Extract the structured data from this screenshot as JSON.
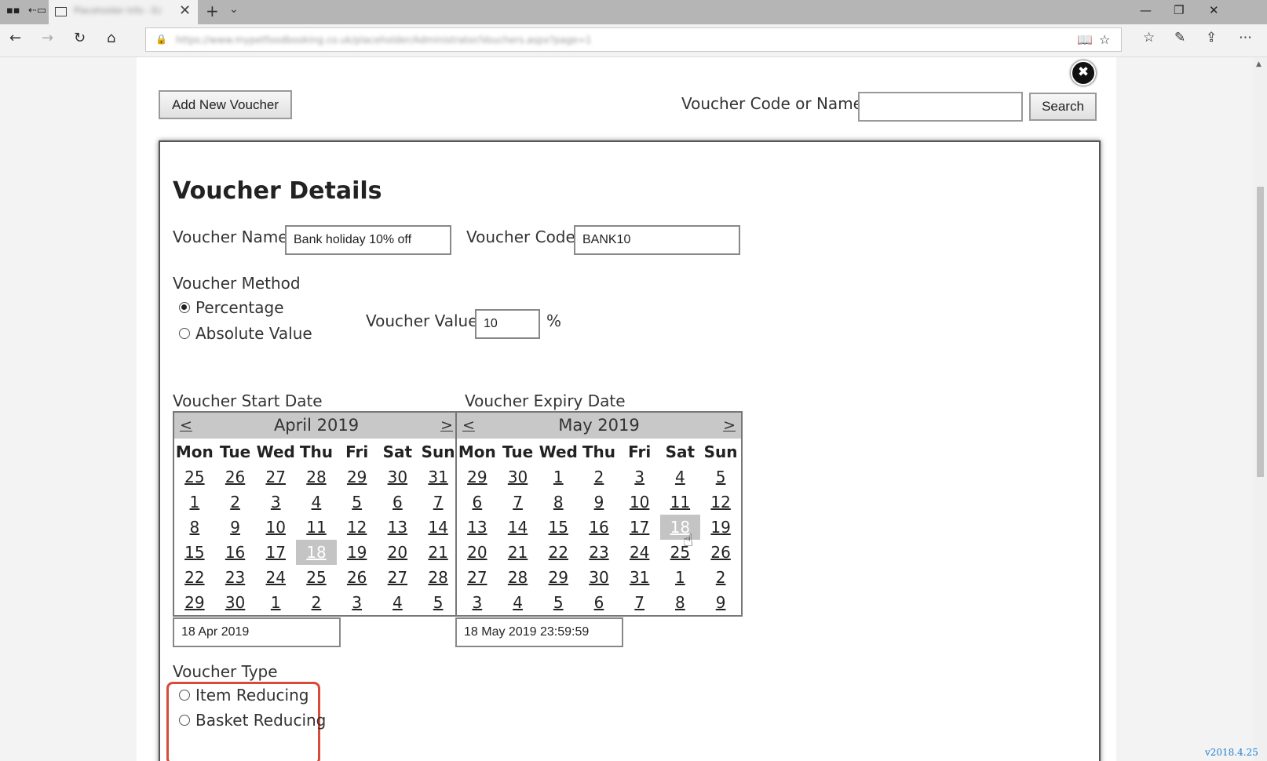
{
  "browser": {
    "tab_title": "Placeholder Info - Ec",
    "url": "https://www.mypetfoodbooking.co.uk/placeholder/Administrator/Vouchers.aspx?page=1",
    "icons": {
      "task_view": "task-view-icon",
      "back_tabs": "set-tabs-aside-icon",
      "tab": "page-icon",
      "close": "✕",
      "new_tab": "+",
      "tab_menu": "⌄",
      "minimize": "—",
      "restore": "❐",
      "win_close": "✕",
      "back": "←",
      "forward": "→",
      "refresh": "↻",
      "home": "⌂",
      "lock": "🔒",
      "reading": "📖",
      "favorite": "☆",
      "favorites": "☆",
      "pen": "✎",
      "share": "⇪",
      "more": "⋯"
    }
  },
  "toolbar": {
    "add_voucher_label": "Add New Voucher",
    "search_label": "Voucher Code or Name:",
    "search_value": "",
    "search_button": "Search",
    "close_icon": "✖"
  },
  "details": {
    "heading": "Voucher Details",
    "name_label": "Voucher Name",
    "name_value": "Bank holiday 10% off",
    "code_label": "Voucher Code",
    "code_value": "BANK10",
    "method_label": "Voucher Method",
    "method_percentage": "Percentage",
    "method_absolute": "Absolute Value",
    "value_label": "Voucher Value",
    "value_value": "10",
    "value_unit": "%",
    "start_label": "Voucher Start Date",
    "expiry_label": "Voucher Expiry Date",
    "start_value": "18 Apr 2019",
    "expiry_value": "18 May 2019 23:59:59",
    "type_label": "Voucher Type",
    "type_item": "Item Reducing",
    "type_basket": "Basket Reducing"
  },
  "calendars": {
    "weekdays": [
      "Mon",
      "Tue",
      "Wed",
      "Thu",
      "Fri",
      "Sat",
      "Sun"
    ],
    "start": {
      "prev": "<",
      "next": ">",
      "title": "April 2019",
      "selected": "18",
      "weeks": [
        [
          "25",
          "26",
          "27",
          "28",
          "29",
          "30",
          "31"
        ],
        [
          "1",
          "2",
          "3",
          "4",
          "5",
          "6",
          "7"
        ],
        [
          "8",
          "9",
          "10",
          "11",
          "12",
          "13",
          "14"
        ],
        [
          "15",
          "16",
          "17",
          "18",
          "19",
          "20",
          "21"
        ],
        [
          "22",
          "23",
          "24",
          "25",
          "26",
          "27",
          "28"
        ],
        [
          "29",
          "30",
          "1",
          "2",
          "3",
          "4",
          "5"
        ]
      ]
    },
    "expiry": {
      "prev": "<",
      "next": ">",
      "title": "May 2019",
      "selected": "18",
      "weeks": [
        [
          "29",
          "30",
          "1",
          "2",
          "3",
          "4",
          "5"
        ],
        [
          "6",
          "7",
          "8",
          "9",
          "10",
          "11",
          "12"
        ],
        [
          "13",
          "14",
          "15",
          "16",
          "17",
          "18",
          "19"
        ],
        [
          "20",
          "21",
          "22",
          "23",
          "24",
          "25",
          "26"
        ],
        [
          "27",
          "28",
          "29",
          "30",
          "31",
          "1",
          "2"
        ],
        [
          "3",
          "4",
          "5",
          "6",
          "7",
          "8",
          "9"
        ]
      ]
    }
  },
  "footer": {
    "version": "v2018.4.25"
  }
}
